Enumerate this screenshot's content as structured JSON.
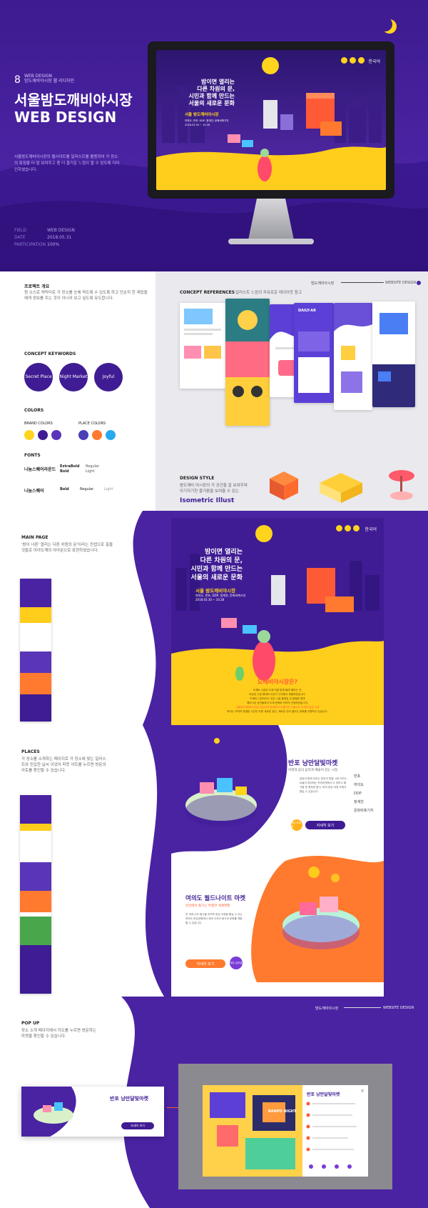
{
  "hero": {
    "number": "8",
    "tag_line1": "WEB DESIGN",
    "tag_line2": "밤도깨비야시장 웹 리디자인",
    "title_line1": "서울밤도깨비야시장",
    "title_line2": "WEB DESIGN",
    "description": "서울밤도깨비야시장의 웹사이트를 일러스트를 활용하여 각 장소의 특징을 더 잘 보여주고 좀 더 즐거운 느낌이 들 수 있도록 디자인하였습니다.",
    "meta": [
      {
        "key": "FIELD",
        "value": "WEB DESIGN"
      },
      {
        "key": "DATE",
        "value": "2018.05.31"
      },
      {
        "key": "PARTICIPATION",
        "value": "100%"
      }
    ],
    "screen": {
      "headline_1": "밤이면 열리는",
      "headline_2": "다른 차원의 문,",
      "headline_3": "시민과 함께 만드는",
      "headline_4": "서울의 새로운 문화",
      "sub_title": "서울 밤도깨비야시장",
      "sub_text_1": "여의도, 반포, DDP, 청계천, 문화비축기지",
      "sub_text_2": "2018.03.30 ~ 10.28",
      "lang": "한국어"
    }
  },
  "concept": {
    "header_label": "밤도깨비야시장",
    "header_right": "WEBSITE DESIGN",
    "overview_title": "프로젝트 개요",
    "overview_text": "원 소스로 캐릭터로 각 장소를 눈에 띄도록 수 있도록 하고 단순히 한 재밌들에게 정보를 주는 것이 아니라 보고 싶도록 유도합니다.",
    "keywords_title": "CONCEPT KEYWORDS",
    "keywords": [
      "Secret Place",
      "Night Market",
      "Joyful"
    ],
    "colors_title": "COLORS",
    "brand_colors_label": "BRAND COLORS",
    "place_colors_label": "PLACE COLORS",
    "brand_colors": [
      "#ffd41c",
      "#3f1c94",
      "#5a35b8"
    ],
    "place_colors": [
      "#4a3fb5",
      "#ff7a2e",
      "#29a8f0"
    ],
    "fonts_title": "FONTS",
    "font1_name": "나눔스퀘어라운드",
    "font1_w1": "ExtraBold",
    "font1_w1b": "Bold",
    "font1_w2": "Regular",
    "font1_w2b": "Light",
    "font2_name": "나눔스퀘어",
    "font2_w1": "Bold",
    "font2_w2": "Regular",
    "font2_w3": "Light",
    "references_title": "CONCEPT REFERENCES",
    "references_text": "일러스트 느낌의 자유로운 레이아웃 참고",
    "style_title": "DESIGN STYLE",
    "style_text_1": "밤도깨비 야시장의 각 공간을 잘 보여주며",
    "style_text_2": "아기자기한 즐거움을 보여줄 수 있는",
    "style_emphasis": "Isometric Illust",
    "ref_daily": "DAILY-AR"
  },
  "main_page": {
    "title": "MAIN PAGE",
    "text": "'밤이 너른' 열리는 다른 차원의 문'이라는 컨셉으로 흥을 것들로 야야도깨의 야야문으로 표현하였습니다.",
    "headline_1": "밤이면 열리는",
    "headline_2": "다른 차원의 문,",
    "headline_3": "시민과 함께 만드는",
    "headline_4": "서울의 새로운 문화",
    "sub_title": "서울 밤도깨비야시장",
    "sub_text_1": "여의도, 반포, DDP, 청계천, 문화비축기지",
    "sub_text_2": "2018.03.30 ~ 10.28",
    "lang": "한국어",
    "about_title": "도깨비야시장은?",
    "about_text_1": "도깨비 시장은 도깨 처럼 밤에 몰래 열리는 곳,",
    "about_text_2": "비상업 시장 형태의 오픈기 시대에서 체험하였습니다.",
    "about_text_3": "도깨비 시장이라는 것은 시골 플레임 뒤 발행된 용과",
    "about_text_4": "깨비시장 상인들에서 도깨 문화와 익어의 인정하였습니다.",
    "about_emphasis": "서울밤도깨비야시장은 젊은이와 함께하고 아름다운 서울이는 도깨비 같은 시장",
    "about_text_5": "마이는 지역과 특별한 시간이 되면 새로운 공간, 새로운 것이 열리는 문화를 지향하고 있습니다."
  },
  "places": {
    "title": "PLACES",
    "text": "각 장소를 소개하는 페이지로 각 장소에 맞는 일러스트와 진입한 날씨 이었어 따뜻 아트를 누르면 방문의 아토를 확인할 수 있습니다.",
    "place1_title": "반포 낭만달빛마켓",
    "place1_sub": "야경과 음식 음악과 예술이 있는 시장",
    "place1_desc": "달빛이 함께 어우는 한강의 특별 시장 아티스트들이 참여하는 프리마켓에서 다 양하고 즐거움 등 풍부한 음식, 바미 한강 야경 속에서 즐길 수 있습니다.",
    "place1_btn": "자세히 보기",
    "place1_date": "매주 토요일",
    "menu_items": [
      "반포",
      "여의도",
      "DDP",
      "청계천",
      "문화비축기지"
    ],
    "place2_title": "여의도 월드나이트 마켓",
    "place2_sub": "한강에서 즐기는 특별한 세계여행",
    "place2_desc": "전 세계 나라 음식을 맛보며 한강 야경을 즐길 수 있는 여의도 한강공원에서 세계 각국의 음식과 문화를 체험할 수 있습니다.",
    "place2_btn": "자세히 보기",
    "place2_date": "매주 금요일"
  },
  "popup": {
    "header_label": "밤도깨비야시장",
    "header_right": "WEBSITE DESIGN",
    "title": "POP UP",
    "text": "장소 소개 페이지에서 지도를 누르면 방문하는 마켓을 확인할 수 있습니다.",
    "card_title": "반포 낭만달빛마켓",
    "card_btn": "자세히 보기",
    "map_title": "반포 낭만달빛마켓",
    "map_label": "BANPO NIGHT"
  }
}
